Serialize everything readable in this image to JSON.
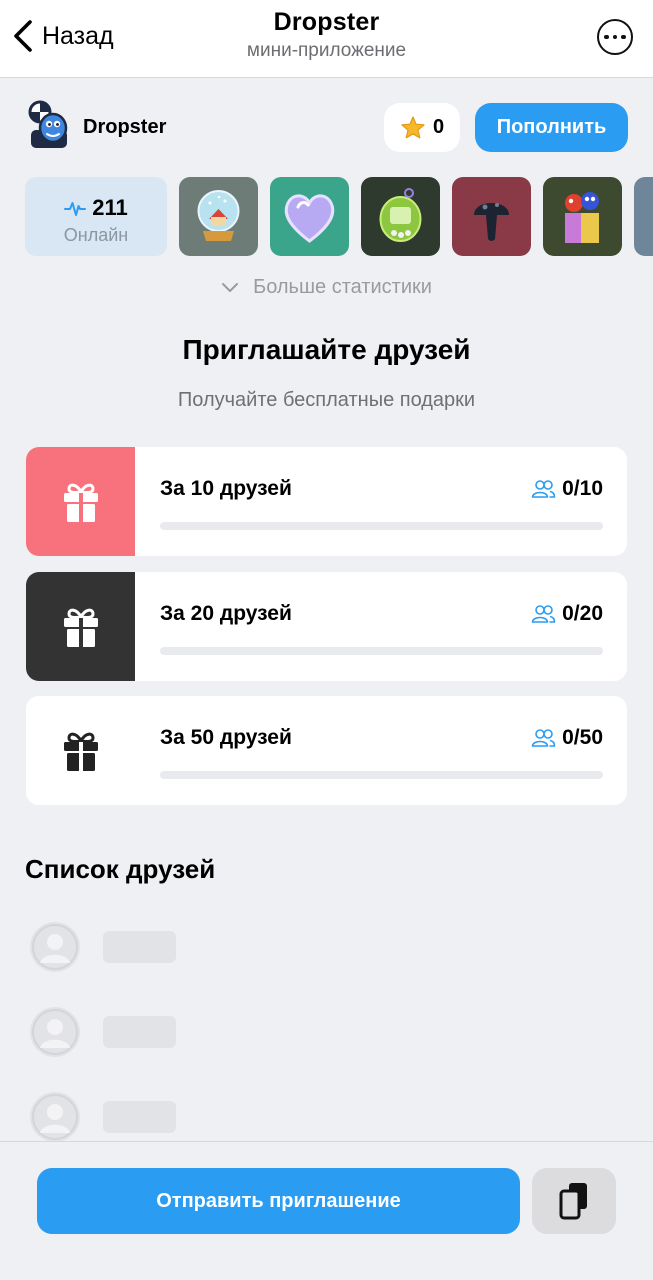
{
  "nav": {
    "back_label": "Назад",
    "title": "Dropster",
    "subtitle": "мини-приложение"
  },
  "header": {
    "brand": "Dropster",
    "stars": "0",
    "topup_label": "Пополнить"
  },
  "stats": {
    "online_count": "211",
    "online_label": "Онлайн",
    "gift_tiles": [
      "snow-globe-icon",
      "heart-gem-icon",
      "tamagotchi-icon",
      "mushroom-icon",
      "toy-box-icon"
    ],
    "more_label": "Больше статистики"
  },
  "invite": {
    "title": "Приглашайте друзей",
    "subtitle": "Получайте бесплатные подарки",
    "rewards": [
      {
        "label": "За 10 друзей",
        "progress": "0/10",
        "fraction": 0,
        "icon_bg": "#f7727d"
      },
      {
        "label": "За 20 друзей",
        "progress": "0/20",
        "fraction": 0,
        "icon_bg": "#333333"
      },
      {
        "label": "За 50 друзей",
        "progress": "0/50",
        "fraction": 0,
        "icon_bg": "#ffffff"
      }
    ]
  },
  "friends": {
    "title": "Список друзей"
  },
  "bottom": {
    "send_label": "Отправить приглашение"
  },
  "colors": {
    "accent": "#2a9cf2",
    "background": "#eff0f3",
    "online_card": "#d8e7f3"
  }
}
